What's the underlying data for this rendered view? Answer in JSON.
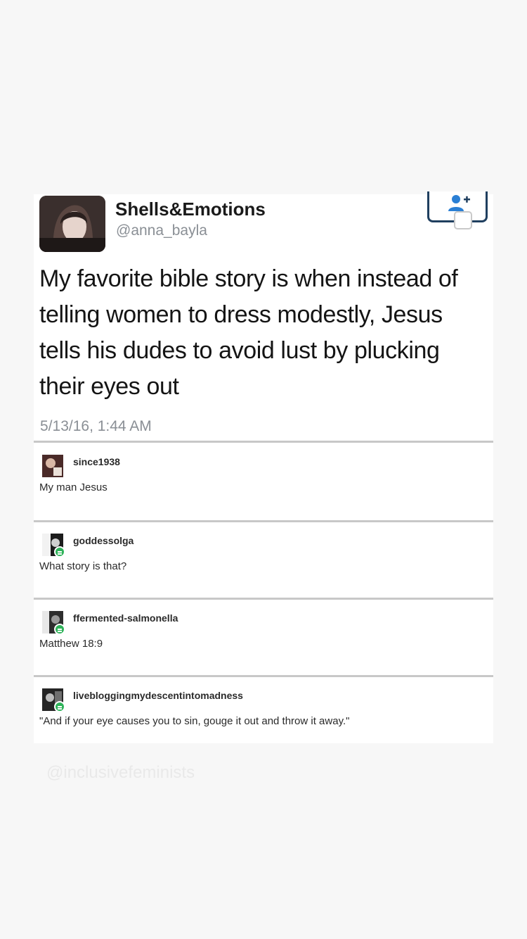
{
  "tweet": {
    "display_name": "Shells&Emotions",
    "handle": "@anna_bayla",
    "text": "My favorite bible story is when instead of telling women to dress modestly, Jesus tells his dudes to avoid lust by plucking their eyes out",
    "timestamp": "5/13/16, 1:44 AM",
    "follow_icon": "add-user-icon"
  },
  "replies": [
    {
      "username": "since1938",
      "text": "My man Jesus"
    },
    {
      "username": "goddessolga",
      "text": "What story is that?"
    },
    {
      "username": "ffermented-salmonella",
      "text": "Matthew 18:9"
    },
    {
      "username": "livebloggingmydescentintomadness",
      "text": "\"And if your eye causes you to sin, gouge it out and throw it away.\""
    }
  ],
  "watermark": "@inclusivefeminists",
  "colors": {
    "background": "#f7f7f7",
    "card": "#ffffff",
    "follow_border": "#1f3f5f",
    "follow_icon": "#2a7fd4",
    "badge": "#2fb35a"
  }
}
